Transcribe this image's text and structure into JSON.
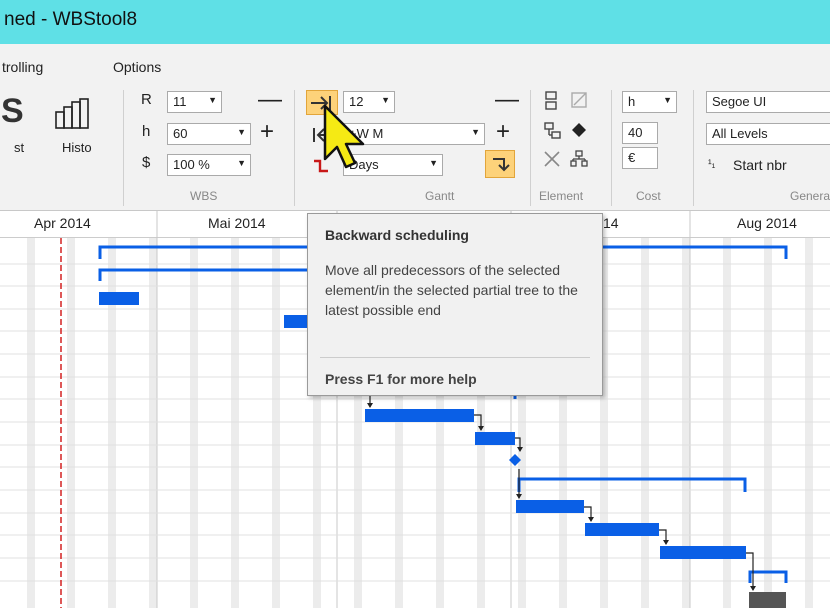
{
  "window": {
    "title": "ned - WBStool8"
  },
  "menu": [
    {
      "label": "trolling"
    },
    {
      "label": "Options"
    }
  ],
  "ribbon": {
    "left": {
      "glyph": "S",
      "label_a": "st",
      "label_b": "Histo"
    },
    "wbs": {
      "r_label": "R",
      "r_value": "11",
      "h_label": "h",
      "h_value": "60",
      "dollar_label": "$",
      "pct_value": "100 %",
      "minus": "—",
      "plus": "+",
      "group_label": "WBS"
    },
    "gantt": {
      "size_value": "12",
      "scale_value": "+W M",
      "unit_value": "Days",
      "minus": "—",
      "plus": "+",
      "group_label": "Gantt"
    },
    "element": {
      "group_label": "Element"
    },
    "cost": {
      "unit_value": "h",
      "amount_value": "40",
      "currency_value": "€",
      "group_label": "Cost"
    },
    "general": {
      "font_value": "Segoe UI",
      "levels_value": "All Levels",
      "start_label": "Start nbr",
      "start_icon": "¹₁",
      "group_label": "Genera"
    }
  },
  "timeline": {
    "months": [
      "Apr 2014",
      "Mai 2014",
      "14",
      "Aug 2014"
    ]
  },
  "tooltip": {
    "title": "Backward scheduling",
    "body": "Move all predecessors of the selected element/in the selected partial tree to the latest possible end",
    "footer": "Press F1 for more help"
  },
  "colors": {
    "title_bar": "#5fe0e6",
    "bar": "#0a5fe6",
    "today_line": "#d42020",
    "highlight": "#fdd27a"
  }
}
